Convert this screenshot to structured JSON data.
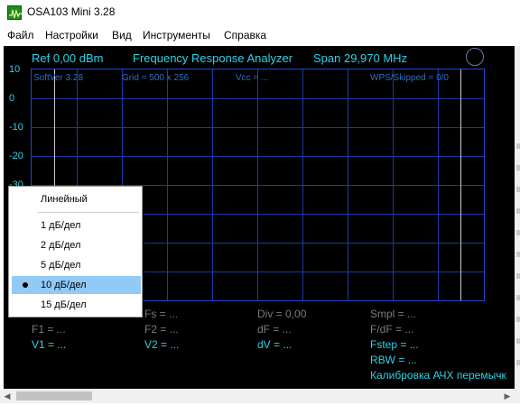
{
  "window": {
    "title": "OSA103 Mini 3.28",
    "icon": "oscilloscope-app-icon"
  },
  "menubar": [
    "Файл",
    "Настройки",
    "Вид",
    "Инструменты",
    "Справка"
  ],
  "header": {
    "ref": "Ref  0,00 dBm",
    "mode": "Frequency Response Analyzer",
    "span": "Span 29,970 MHz"
  },
  "y_axis": [
    "10",
    "0",
    "-10",
    "-20",
    "-30"
  ],
  "grid_info": {
    "soft": "SoftVer 3.28",
    "grid": "Grid = 500 x 256",
    "vcc": "Vcc = ...",
    "wps": "WPS/Skipped  = 0/0"
  },
  "params": {
    "fs": "Fs = ...",
    "div": "Div = 0,00",
    "smpl": "Smpl = ...",
    "f1": "F1 = ...",
    "f2": "F2 = ...",
    "df": "dF = ...",
    "fdf": "F/dF = ...",
    "v1": "V1 = ...",
    "v2": "V2 = ...",
    "dv": "dV = ...",
    "fstep": "Fstep = ...",
    "rbw": "RBW = ...",
    "calib": "Калибровка АЧХ перемычк"
  },
  "context_menu": {
    "items": [
      "Линейный",
      "1 дБ/дел",
      "2 дБ/дел",
      "5 дБ/дел",
      "10 дБ/дел",
      "15 дБ/дел"
    ],
    "selected": "10 дБ/дел"
  },
  "colors": {
    "accent": "#2bd3e6",
    "grid": "#1a3aa8",
    "selection": "#91c9f7",
    "muted": "#7c7c7c"
  }
}
